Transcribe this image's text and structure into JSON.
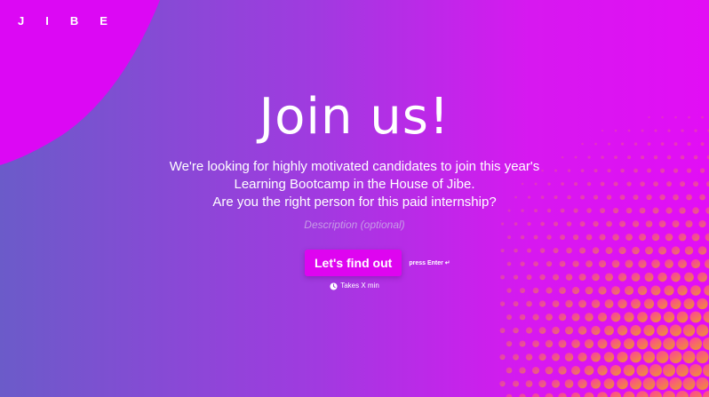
{
  "brand": {
    "logo_text": "JIBE"
  },
  "hero": {
    "title": "Join us!",
    "description_lines": [
      "We're looking for highly motivated candidates to join this year's",
      "Learning Bootcamp in the House of Jibe.",
      "Are you the right person for this paid internship?"
    ],
    "description_placeholder": "Description (optional)"
  },
  "cta": {
    "button_label": "Let's find out",
    "enter_hint": "press Enter ↵",
    "time_estimate": "Takes X min",
    "time_icon": "clock-icon"
  },
  "colors": {
    "background_left": "#6b5bc9",
    "background_right": "#e20ef5",
    "accent": "#de05f0",
    "blob": "#dc08f4",
    "dots_start": "#ff3fa0",
    "dots_end": "#f08a3e"
  }
}
